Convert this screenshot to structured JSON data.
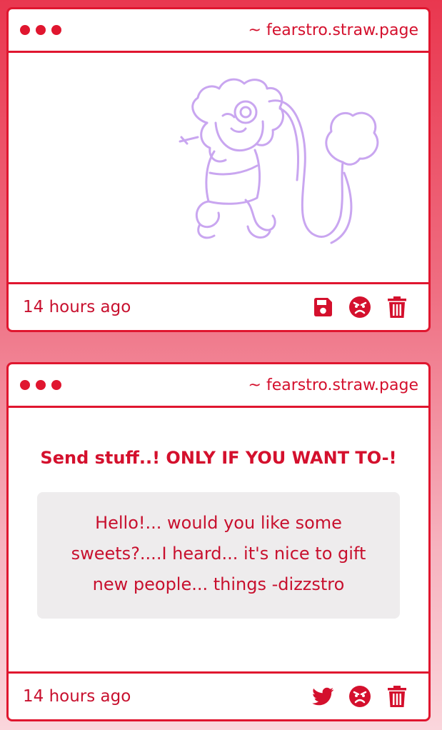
{
  "cards": [
    {
      "site": "~ fearstro.straw.page",
      "time": "14 hours ago",
      "actions": [
        "save-icon",
        "angry-face-icon",
        "trash-icon"
      ]
    },
    {
      "site": "~ fearstro.straw.page",
      "title": "Send stuff..! ONLY IF YOU WANT TO-!",
      "message": "Hello!... would you like some sweets?....I heard... it's nice to gift new people... things -dizzstro",
      "time": "14 hours ago",
      "actions": [
        "twitter-bird-icon",
        "angry-face-icon",
        "trash-icon"
      ]
    }
  ],
  "colors": {
    "accent": "#e0162f",
    "text": "#d4102d",
    "sketch": "#c9a6f0",
    "message_bg": "#eeeced"
  }
}
